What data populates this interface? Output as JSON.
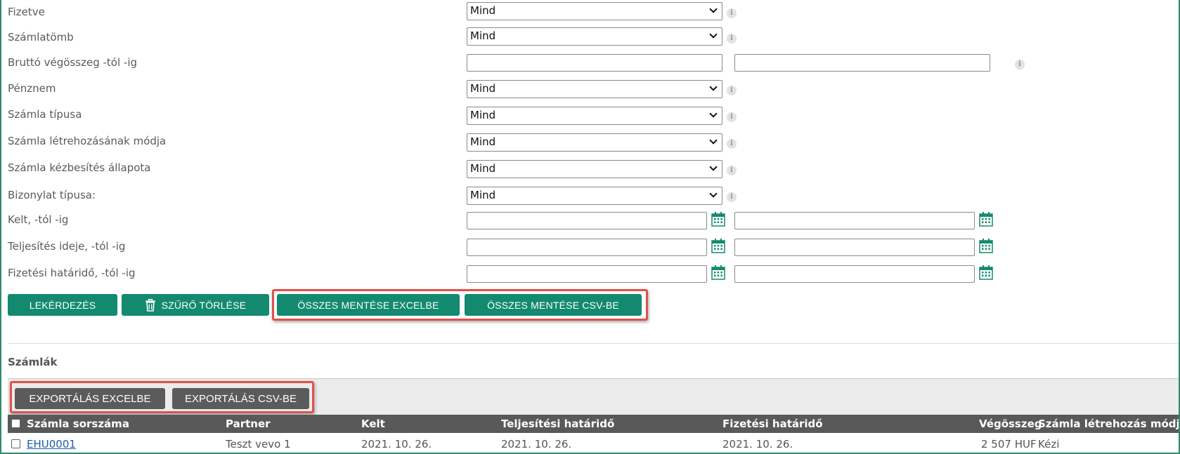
{
  "filters": {
    "paid": {
      "label": "Fizetve",
      "value": "Mind"
    },
    "invoice_block": {
      "label": "Számlatömb",
      "value": "Mind"
    },
    "gross_total_range": {
      "label": "Bruttó végösszeg -tól -ig"
    },
    "currency": {
      "label": "Pénznem",
      "value": "Mind"
    },
    "invoice_type": {
      "label": "Számla típusa",
      "value": "Mind"
    },
    "creation_method": {
      "label": "Számla létrehozásának módja",
      "value": "Mind"
    },
    "delivery_status": {
      "label": "Számla kézbesítés állapota",
      "value": "Mind"
    },
    "document_type": {
      "label": "Bizonylat típusa:",
      "value": "Mind"
    },
    "issue_date_range": {
      "label": "Kelt, -tól -ig"
    },
    "fulfilment_date_range": {
      "label": "Teljesítés ideje, -tól -ig"
    },
    "due_date_range": {
      "label": "Fizetési határidő, -tól -ig"
    }
  },
  "actions": {
    "query": "LEKÉRDEZÉS",
    "clear_filter": "SZŰRŐ TÖRLÉSE",
    "save_all_excel": "ÖSSZES MENTÉSE EXCELBE",
    "save_all_csv": "ÖSSZES MENTÉSE CSV-BE"
  },
  "invoices": {
    "title": "Számlák",
    "export_excel": "EXPORTÁLÁS EXCELBE",
    "export_csv": "EXPORTÁLÁS CSV-BE",
    "columns": {
      "number": "Számla sorszáma",
      "partner": "Partner",
      "issued": "Kelt",
      "fulfilment_deadline": "Teljesítési határidő",
      "payment_deadline": "Fizetési határidő",
      "total": "Végösszeg",
      "creation_method": "Számla létrehozás módja"
    },
    "rows": [
      {
        "number": "EHU0001",
        "partner": "Teszt vevo 1",
        "issued": "2021. 10. 26.",
        "fulfilment_deadline": "2021. 10. 26.",
        "payment_deadline": "2021. 10. 26.",
        "total": "2 507 HUF",
        "creation_method": "Kézi"
      }
    ]
  },
  "colors": {
    "primary_button": "#138a6f",
    "secondary_button": "#5b5b5b",
    "highlight": "#e0524a",
    "table_header": "#595959"
  },
  "icons": {
    "info": "info-icon",
    "calendar": "calendar-icon",
    "trash": "trash-icon",
    "dropdown": "chevron-down-icon"
  }
}
